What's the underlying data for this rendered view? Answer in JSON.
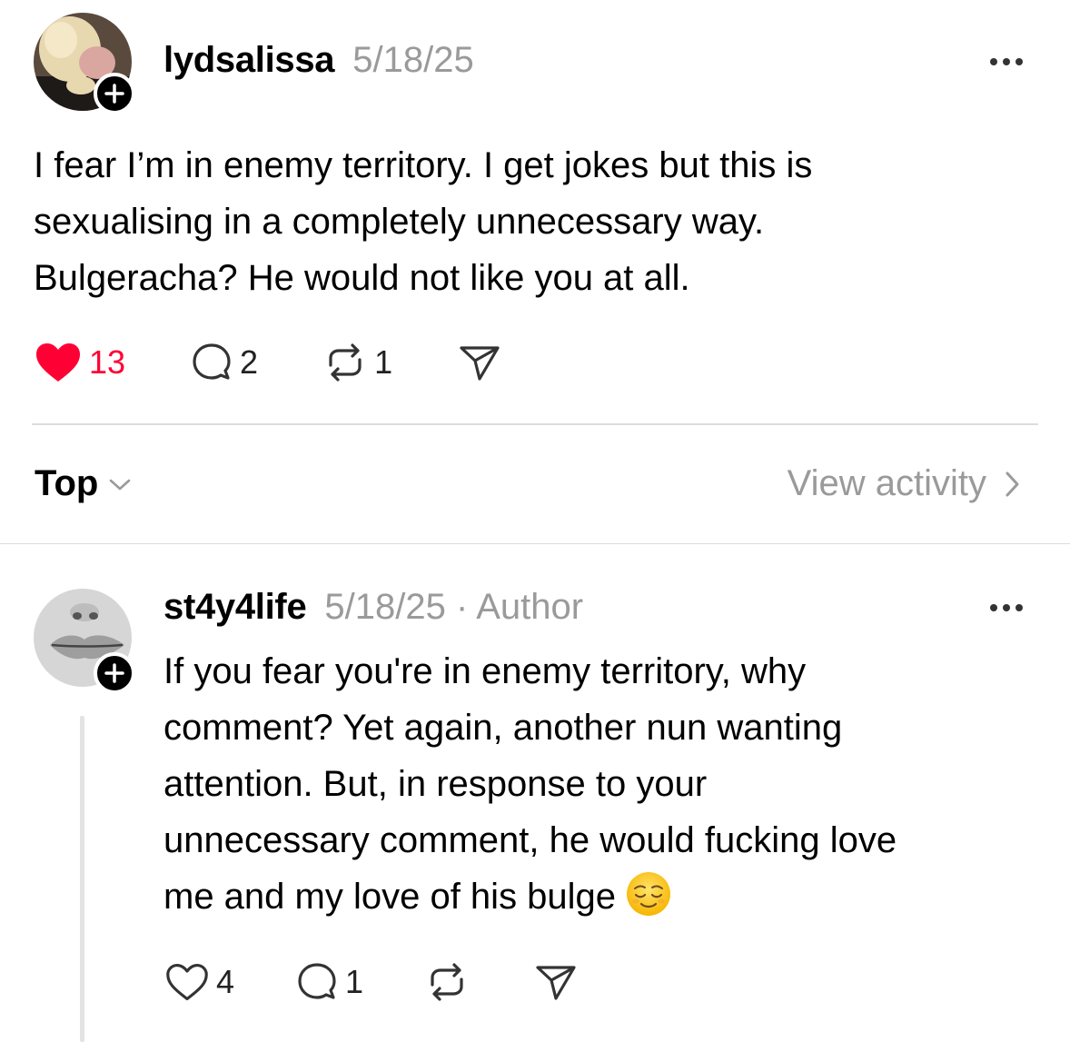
{
  "post": {
    "username": "lydsalissa",
    "date": "5/18/25",
    "text_lines": [
      "I fear I’m in enemy territory. I get jokes but this is",
      "sexualising in a completely unnecessary way.",
      "Bulgeracha? He would not like you at all."
    ],
    "likes": "13",
    "replies": "2",
    "reposts": "1",
    "liked": true,
    "colors": {
      "like": "#ff0034"
    }
  },
  "sort": {
    "label": "Top"
  },
  "activity": {
    "label": "View activity"
  },
  "reply": {
    "username": "st4y4life",
    "meta": "5/18/25 · Author",
    "text_lines": [
      "If you fear you're in enemy territory, why",
      "comment? Yet again, another nun wanting",
      "attention. But, in response to your",
      "unnecessary comment, he would fucking love",
      "me and my love of his bulge"
    ],
    "emoji": "relieved-face-emoji",
    "likes": "4",
    "replies": "1"
  }
}
